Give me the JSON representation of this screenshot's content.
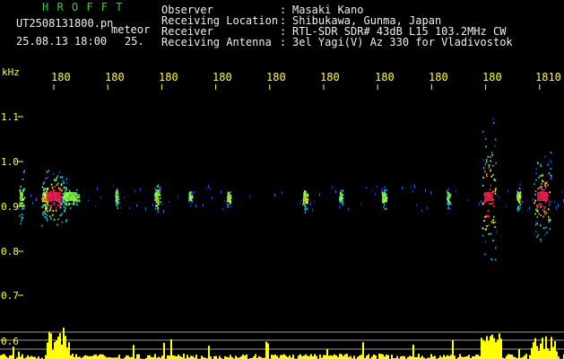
{
  "header": {
    "program": "H R O F F T",
    "filename": "UT2508131800.pn",
    "type_label": "meteor",
    "datetime": "25.08.13 18:00",
    "count": "25.",
    "info": [
      {
        "label": "Observer",
        "value": "Masaki Kano"
      },
      {
        "label": "Receiving Location",
        "value": "Shibukawa, Gunma, Japan"
      },
      {
        "label": "Receiver",
        "value": "RTL-SDR SDR# 43dB L15 103.2MHz CW"
      },
      {
        "label": "Receiving Antenna",
        "value": "3el Yagi(V) Az 330 for Vladivostok"
      }
    ]
  },
  "spectrogram": {
    "y_unit": "kHz",
    "y_ticks": [
      "1.1",
      "1.0",
      "0.9",
      "0.8",
      "0.7",
      "0.6"
    ],
    "x_ticks": [
      "180",
      "180",
      "180",
      "180",
      "180",
      "180",
      "180",
      "180",
      "180",
      "1810"
    ],
    "colors": {
      "background": "#000000",
      "axis_text": "#ffff33",
      "label_text": "#3ec93e",
      "activity": "#ffff00"
    }
  }
}
